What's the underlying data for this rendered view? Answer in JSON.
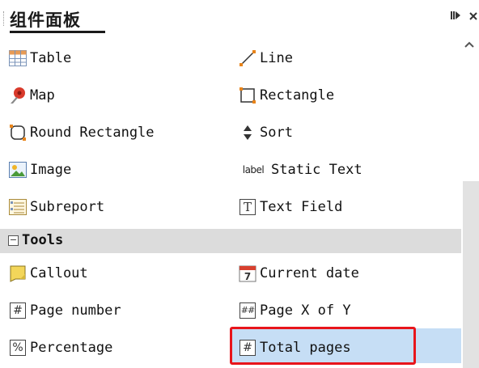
{
  "panel": {
    "title": "组件面板",
    "pin_icon": "pin-icon",
    "close_icon": "close-icon"
  },
  "items": [
    {
      "label": "Table",
      "icon": "table-icon"
    },
    {
      "label": "Line",
      "icon": "line-icon"
    },
    {
      "label": "Map",
      "icon": "map-pin-icon"
    },
    {
      "label": "Rectangle",
      "icon": "rectangle-icon"
    },
    {
      "label": "Round Rectangle",
      "icon": "round-rectangle-icon"
    },
    {
      "label": "Sort",
      "icon": "sort-icon"
    },
    {
      "label": "Image",
      "icon": "image-icon"
    },
    {
      "label": "Static Text",
      "icon": "static-text-icon",
      "icon_text": "label"
    },
    {
      "label": "Subreport",
      "icon": "subreport-icon"
    },
    {
      "label": "Text Field",
      "icon": "text-field-icon",
      "icon_text": "T"
    }
  ],
  "tools_section": {
    "toggle": "−",
    "title": "Tools"
  },
  "tools": [
    {
      "label": "Callout",
      "icon": "callout-icon"
    },
    {
      "label": "Current date",
      "icon": "calendar-icon",
      "icon_text": "7"
    },
    {
      "label": "Page number",
      "icon": "page-number-icon",
      "icon_text": "#"
    },
    {
      "label": "Page X of Y",
      "icon": "page-x-of-y-icon",
      "icon_text": "##"
    },
    {
      "label": "Percentage",
      "icon": "percentage-icon",
      "icon_text": "%"
    },
    {
      "label": "Total pages",
      "icon": "total-pages-icon",
      "icon_text": "#",
      "selected": true
    }
  ],
  "colors": {
    "selection": "#c6def5",
    "highlight_border": "#e8151b",
    "section_bg": "#dcdcdc"
  }
}
